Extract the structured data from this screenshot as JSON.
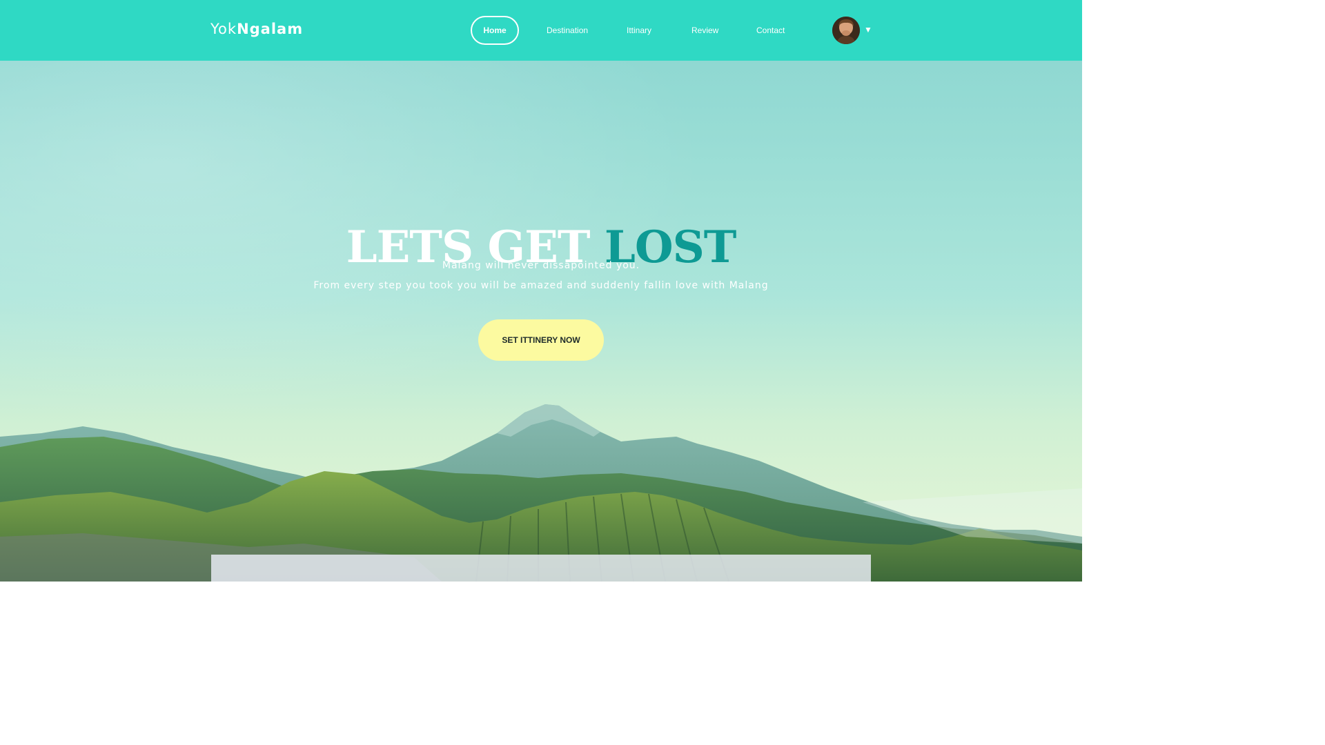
{
  "brand": {
    "logo_light": "Yok",
    "logo_bold": "Ngalam"
  },
  "nav": {
    "items": [
      {
        "label": "Home",
        "active": true
      },
      {
        "label": "Destination",
        "active": false
      },
      {
        "label": "Ittinary",
        "active": false
      },
      {
        "label": "Review",
        "active": false
      },
      {
        "label": "Contact",
        "active": false
      }
    ],
    "caret_icon": "▼",
    "avatar_icon": "user-avatar"
  },
  "hero": {
    "title_part1": "LETS GET",
    "title_part2": "LOST",
    "subtitle_line1": "Malang will never dissapointed you.",
    "subtitle_line2": "From every step you took you will be amazed and suddenly fallin love with Malang",
    "cta_label": "SET ITTINERY NOW"
  },
  "colors": {
    "navbar": "#2fd9c4",
    "accent_title": "#0e9a94",
    "cta_background": "#fcfaa0",
    "text_light": "#ffffff"
  }
}
